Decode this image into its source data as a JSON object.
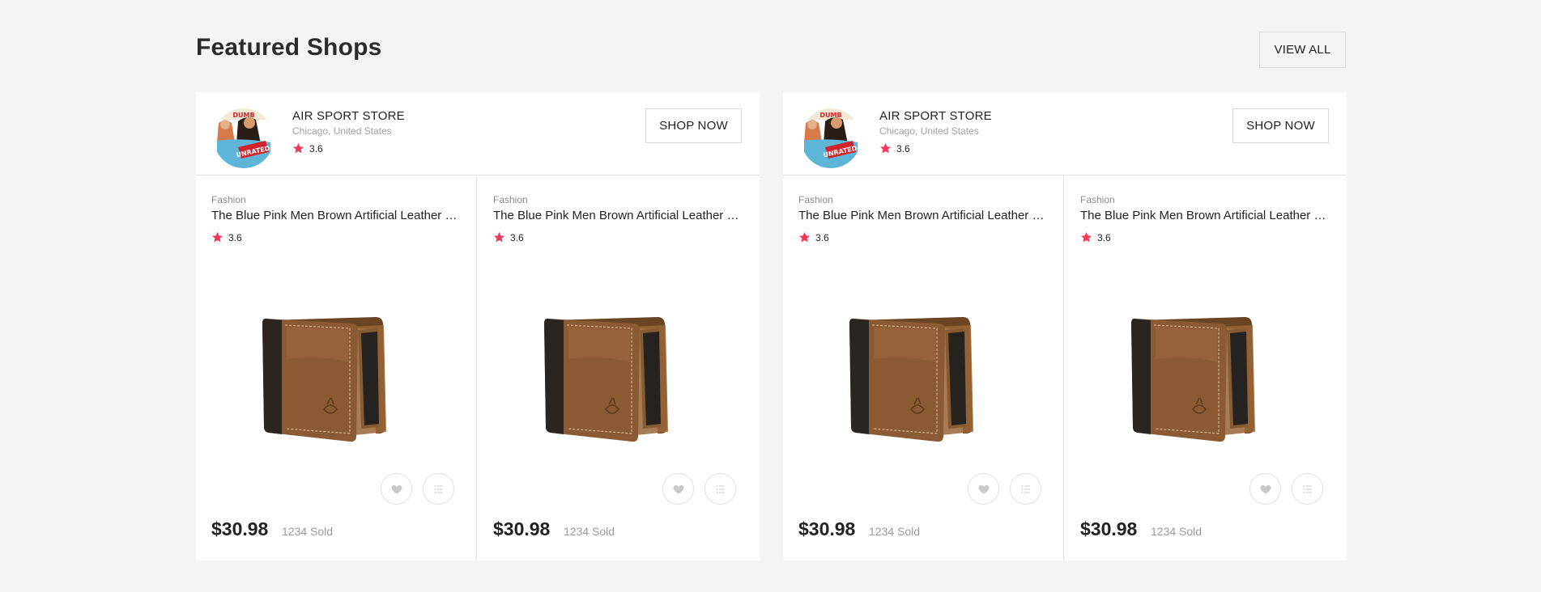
{
  "section": {
    "title": "Featured Shops",
    "view_all_label": "VIEW ALL"
  },
  "colors": {
    "star": "#f0385a",
    "background": "#f4f4f4"
  },
  "shops": [
    {
      "name": "AIR SPORT STORE",
      "location": "Chicago, United States",
      "rating": "3.6",
      "shop_now_label": "SHOP NOW",
      "products": [
        {
          "category": "Fashion",
          "title": "The Blue Pink Men Brown Artificial Leather Wallet",
          "rating": "3.6",
          "price": "$30.98",
          "sold": "1234 Sold"
        },
        {
          "category": "Fashion",
          "title": "The Blue Pink Men Brown Artificial Leather Wallet",
          "rating": "3.6",
          "price": "$30.98",
          "sold": "1234 Sold"
        }
      ]
    },
    {
      "name": "AIR SPORT STORE",
      "location": "Chicago, United States",
      "rating": "3.6",
      "shop_now_label": "SHOP NOW",
      "products": [
        {
          "category": "Fashion",
          "title": "The Blue Pink Men Brown Artificial Leather Wallet",
          "rating": "3.6",
          "price": "$30.98",
          "sold": "1234 Sold"
        },
        {
          "category": "Fashion",
          "title": "The Blue Pink Men Brown Artificial Leather Wallet",
          "rating": "3.6",
          "price": "$30.98",
          "sold": "1234 Sold"
        }
      ]
    }
  ],
  "icons": {
    "rating": "star-icon",
    "wishlist": "heart-icon",
    "compare": "list-icon"
  }
}
